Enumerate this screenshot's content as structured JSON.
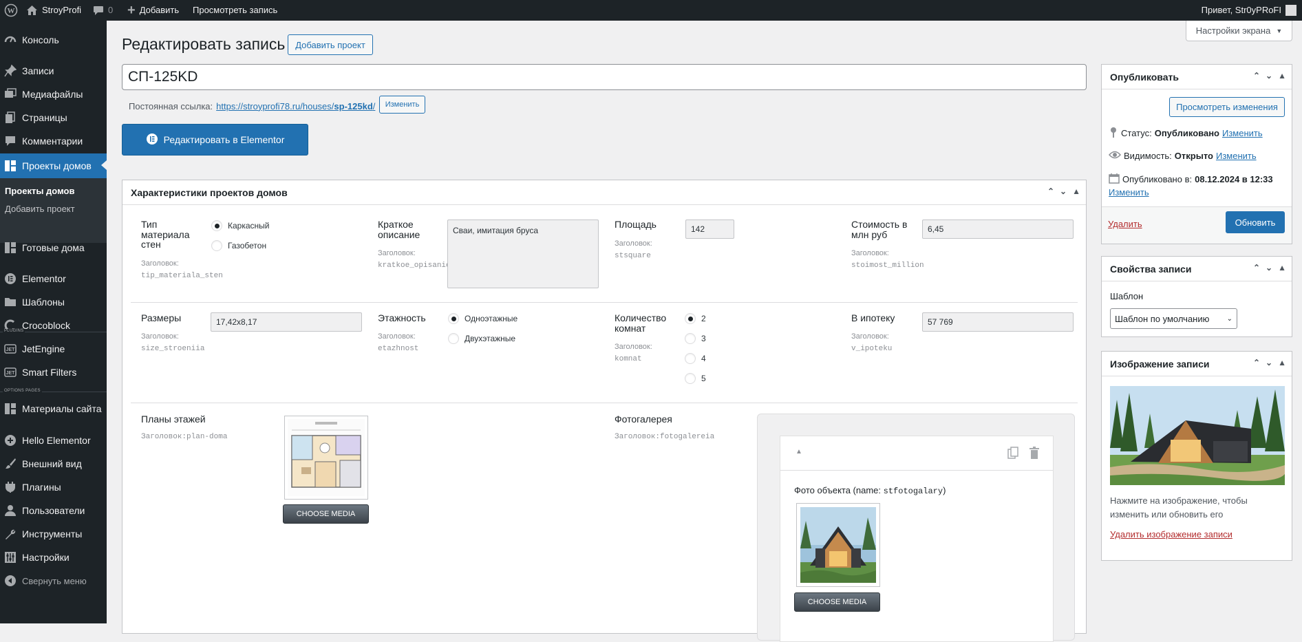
{
  "adminbar": {
    "site_name": "StroyProfi",
    "comments_count": "0",
    "add_label": "Добавить",
    "view_post_label": "Просмотреть запись",
    "greeting": "Привет, Str0yPRoFI"
  },
  "sidebar": {
    "items": {
      "console": "Консоль",
      "posts": "Записи",
      "media": "Медиафайлы",
      "pages": "Страницы",
      "comments": "Комментарии",
      "projects": "Проекты домов",
      "ready_houses": "Готовые дома",
      "elementor": "Elementor",
      "templates": "Шаблоны",
      "crocoblock": "Crocoblock",
      "jetengine": "JetEngine",
      "smart_filters": "Smart Filters",
      "site_materials": "Материалы сайта",
      "hello_elementor": "Hello Elementor",
      "appearance": "Внешний вид",
      "plugins": "Плагины",
      "users": "Пользователи",
      "tools": "Инструменты",
      "settings": "Настройки",
      "collapse": "Свернуть меню"
    },
    "submenu": {
      "all_projects": "Проекты домов",
      "add_project": "Добавить проект"
    },
    "separators": {
      "plugins": "PLUGINS",
      "options": "OPTIONS PAGES"
    }
  },
  "page": {
    "title": "Редактировать запись",
    "add_button": "Добавить проект",
    "screen_options": "Настройки экрана",
    "post_title": "СП-125KD",
    "permalink_label": "Постоянная ссылка:",
    "permalink_url_base": "https://stroyprofi78.ru/houses/",
    "permalink_slug": "sp-125kd",
    "permalink_url_end": "/",
    "permalink_edit": "Изменить",
    "elementor_button": "Редактировать в Elementor"
  },
  "metabox": {
    "title": "Характеристики проектов домов",
    "hint_prefix": "Заголовок:",
    "fields": {
      "wall_type": {
        "label": "Тип материала стен",
        "key": "tip_materiala_sten",
        "options": [
          "Каркасный",
          "Газобетон"
        ],
        "selected": "Каркасный"
      },
      "short_desc": {
        "label": "Краткое описание",
        "key": "kratkoe_opisanie",
        "value": "Сваи, имитация бруса"
      },
      "area": {
        "label": "Площадь",
        "key": "stsquare",
        "value": "142"
      },
      "price": {
        "label": "Стоимость в млн руб",
        "key": "stoimost_million",
        "value": "6,45"
      },
      "size": {
        "label": "Размеры",
        "key": "size_stroeniia",
        "value": "17,42х8,17"
      },
      "floors": {
        "label": "Этажность",
        "key": "etazhnost",
        "options": [
          "Одноэтажные",
          "Двухэтажные"
        ],
        "selected": "Одноэтажные"
      },
      "rooms": {
        "label": "Количество комнат",
        "key": "komnat",
        "options": [
          "2",
          "3",
          "4",
          "5"
        ],
        "selected": "2"
      },
      "mortgage": {
        "label": "В ипотеку",
        "key": "v_ipoteku",
        "value": "57 769"
      },
      "floor_plans": {
        "label": "Планы этажей",
        "hint": "Заголовок:plan-doma",
        "button": "CHOOSE MEDIA"
      },
      "gallery": {
        "label": "Фотогалерея",
        "hint": "Заголовок:fotogalereia",
        "item_label": "Фото объекта (name: ",
        "item_name": "stfotogalary",
        "item_label_end": ")",
        "button": "CHOOSE MEDIA"
      }
    }
  },
  "publish": {
    "title": "Опубликовать",
    "preview_button": "Просмотреть изменения",
    "status_label": "Статус:",
    "status_value": "Опубликовано",
    "visibility_label": "Видимость:",
    "visibility_value": "Открыто",
    "published_label": "Опубликовано в:",
    "published_value": "08.12.2024 в 12:33",
    "edit_link": "Изменить",
    "delete_link": "Удалить",
    "update_button": "Обновить"
  },
  "post_attributes": {
    "title": "Свойства записи",
    "template_label": "Шаблон",
    "template_value": "Шаблон по умолчанию"
  },
  "featured_image": {
    "title": "Изображение записи",
    "hint": "Нажмите на изображение, чтобы изменить или обновить его",
    "remove_link": "Удалить изображение записи"
  },
  "colors": {
    "accent": "#2271b1",
    "adminbar": "#1d2327",
    "danger": "#b32d2e"
  }
}
